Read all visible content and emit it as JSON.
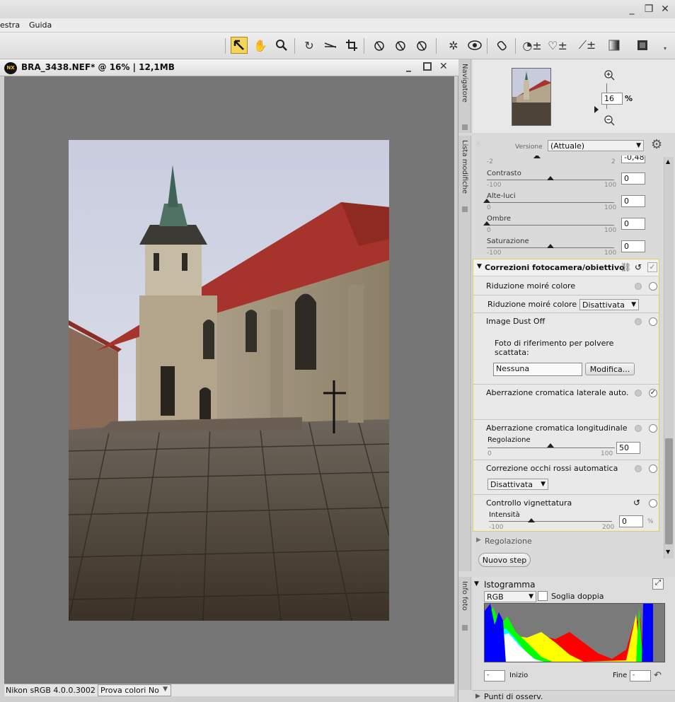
{
  "menu": {
    "items": [
      "estra",
      "Guida"
    ]
  },
  "window_controls": {
    "minimize": "_",
    "restore": "❐",
    "close": "✕"
  },
  "document": {
    "title": "BRA_3438.NEF* @ 16% | 12,1MB",
    "logo_text": "NX",
    "color_profile": "Nikon sRGB 4.0.0.3002",
    "proof": "Prova colori No"
  },
  "navigator": {
    "tab_label": "Navigatore",
    "zoom_value": "16",
    "zoom_unit": "%"
  },
  "edit_list": {
    "tab_label": "Lista modifiche",
    "version_label": "Versione",
    "version_value": "(Attuale)",
    "top_slider": {
      "min": "-2",
      "max": "2",
      "value": "-0,48"
    },
    "sliders": [
      {
        "label": "Contrasto",
        "min": "-100",
        "max": "100",
        "value": "0"
      },
      {
        "label": "Alte-luci",
        "min": "0",
        "max": "100",
        "value": "0"
      },
      {
        "label": "Ombre",
        "min": "0",
        "max": "100",
        "value": "0"
      },
      {
        "label": "Saturazione",
        "min": "-100",
        "max": "100",
        "value": "0"
      }
    ],
    "camera_section": {
      "title": "Correzioni fotocamera/obiettivo",
      "moire_title": "Riduzione moiré colore",
      "moire_label": "Riduzione moiré colore",
      "moire_value": "Disattivata",
      "dust_title": "Image Dust Off",
      "dust_desc": "Foto di riferimento per polvere scattata:",
      "dust_value": "Nessuna",
      "dust_button": "Modifica...",
      "lateral_title": "Aberrazione cromatica laterale auto.",
      "longitudinal_title": "Aberrazione cromatica longitudinale",
      "longitudinal_slider": {
        "label": "Regolazione",
        "min": "0",
        "max": "100",
        "value": "50"
      },
      "redeye_title": "Correzione occhi rossi automatica",
      "redeye_value": "Disattivata",
      "vignette_title": "Controllo vignettatura",
      "vignette_slider": {
        "label": "Intensità",
        "min": "-100",
        "max": "200",
        "value": "0",
        "unit": "%"
      }
    },
    "regolazione_label": "Regolazione",
    "new_step_button": "Nuovo step"
  },
  "info": {
    "tab_label": "Info foto",
    "histogram_title": "Istogramma",
    "channel": "RGB",
    "double_threshold": "Soglia doppia",
    "start_label": "Inizio",
    "start_value": "-",
    "end_label": "Fine",
    "end_value": "-"
  },
  "watch_points": {
    "label": "Punti di osserv."
  }
}
